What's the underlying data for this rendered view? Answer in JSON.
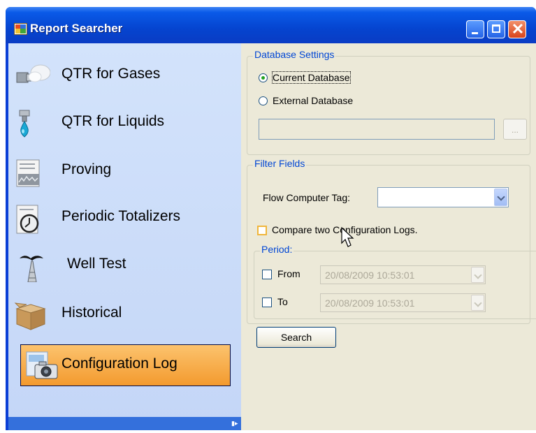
{
  "window": {
    "title": "Report Searcher",
    "icon": "app-grid-icon"
  },
  "sidebar": {
    "items": [
      {
        "label": "QTR for Gases",
        "icon": "gas-pipe-icon"
      },
      {
        "label": "QTR for Liquids",
        "icon": "liquid-drop-icon"
      },
      {
        "label": "Proving",
        "icon": "proving-chart-icon"
      },
      {
        "label": "Periodic Totalizers",
        "icon": "clock-icon"
      },
      {
        "label": "Well Test",
        "icon": "oil-well-icon"
      },
      {
        "label": "Historical",
        "icon": "box-icon"
      },
      {
        "label": "Configuration Log",
        "icon": "camera-icon",
        "selected": true
      }
    ]
  },
  "database_settings": {
    "title": "Database Settings",
    "current_label": "Current Database",
    "external_label": "External Database",
    "path_value": "",
    "browse_label": "..."
  },
  "filter_fields": {
    "title": "Filter Fields",
    "flow_computer_tag_label": "Flow Computer Tag:",
    "flow_computer_tag_value": "",
    "compare_label": "Compare two Configuration Logs.",
    "period": {
      "title": "Period:",
      "from_label": "From",
      "from_value": "20/08/2009 10:53:01",
      "to_label": "To",
      "to_value": "20/08/2009 10:53:01"
    }
  },
  "search_button_label": "Search",
  "colors": {
    "title_bar": "#0544cf",
    "sidebar": "#c8daf8",
    "selected_item": "#f5a33c",
    "panel": "#ece9d8",
    "group_title": "#0046d5"
  }
}
